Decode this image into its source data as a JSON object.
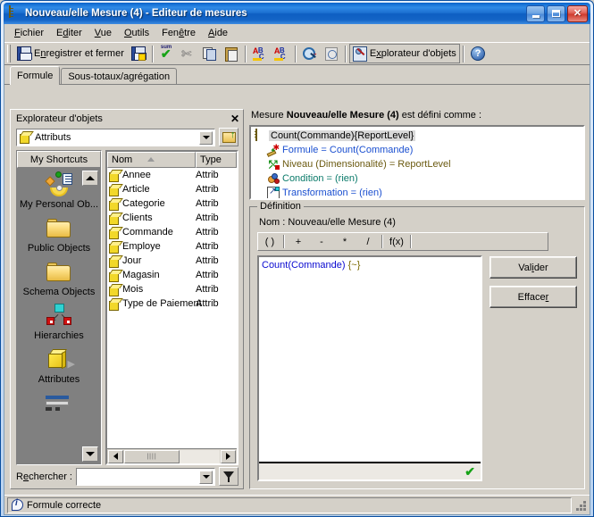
{
  "window": {
    "title": "Nouveau/elle Mesure (4) - Editeur de mesures",
    "icon": "ruler-icon",
    "buttons": {
      "minimize": "minimize-icon",
      "maximize": "maximize-icon",
      "close": "close-icon"
    }
  },
  "menubar": [
    {
      "label": "Fichier",
      "accel": "F"
    },
    {
      "label": "Editer",
      "accel": "d"
    },
    {
      "label": "Vue",
      "accel": "V"
    },
    {
      "label": "Outils",
      "accel": "O"
    },
    {
      "label": "Fenêtre",
      "accel": "ê"
    },
    {
      "label": "Aide",
      "accel": "A"
    }
  ],
  "toolbar": {
    "save_and_close": {
      "label": "Enregistrer et fermer",
      "icon": "save-icon"
    },
    "save_as": {
      "icon": "save-as-icon"
    },
    "validate": {
      "icon": "sum-check-icon"
    },
    "cut": {
      "icon": "scissors-icon"
    },
    "copy": {
      "icon": "copy-icon"
    },
    "paste": {
      "icon": "paste-icon"
    },
    "spell1": {
      "icon": "abc-sort-icon"
    },
    "spell2": {
      "icon": "abc-sort-desc-icon"
    },
    "find": {
      "icon": "find-icon"
    },
    "find_next": {
      "icon": "find-next-icon"
    },
    "object_explorer": {
      "label": "Explorateur d'objets",
      "icon": "object-explorer-icon"
    },
    "help": {
      "icon": "help-icon"
    }
  },
  "tabs": [
    {
      "label": "Formule",
      "active": true
    },
    {
      "label": "Sous-totaux/agrégation",
      "active": false
    }
  ],
  "object_explorer": {
    "title": "Explorateur d'objets",
    "close_label": "✕",
    "combo": {
      "value": "Attributs",
      "icon": "cube-icon"
    },
    "up_button_icon": "folder-up-icon",
    "shortcuts_title": "My Shortcuts",
    "shortcuts": [
      {
        "label": "My Personal Ob...",
        "icon": "personal-objects-icon"
      },
      {
        "label": "Public Objects",
        "icon": "folder-icon"
      },
      {
        "label": "Schema Objects",
        "icon": "folder-icon"
      },
      {
        "label": "Hierarchies",
        "icon": "hierarchies-icon"
      },
      {
        "label": "Attributes",
        "icon": "attributes-cube-icon"
      },
      {
        "label": "",
        "icon": "metrics-bar-icon"
      }
    ],
    "columns": [
      "Nom",
      "Type"
    ],
    "sort_column": "Nom",
    "sort_direction": "asc",
    "rows": [
      {
        "name": "Annee",
        "type": "Attrib"
      },
      {
        "name": "Article",
        "type": "Attrib"
      },
      {
        "name": "Categorie",
        "type": "Attrib"
      },
      {
        "name": "Clients",
        "type": "Attrib"
      },
      {
        "name": "Commande",
        "type": "Attrib"
      },
      {
        "name": "Employe",
        "type": "Attrib"
      },
      {
        "name": "Jour",
        "type": "Attrib"
      },
      {
        "name": "Magasin",
        "type": "Attrib"
      },
      {
        "name": "Mois",
        "type": "Attrib"
      },
      {
        "name": "Type de Paiement",
        "type": "Attrib"
      }
    ],
    "search": {
      "label": "Rechercher :",
      "value": "",
      "placeholder": "",
      "filter_icon": "funnel-icon"
    }
  },
  "measure": {
    "caption_prefix": "Mesure",
    "name": "Nouveau/elle Mesure (4)",
    "caption_suffix": "est défini comme :",
    "tree": [
      {
        "text": "Count(Commande){ReportLevel}",
        "icon": "ruler-icon",
        "selected": true,
        "color": "#000000"
      },
      {
        "text": "Formule = Count(Commande)",
        "icon": "formula-icon",
        "color": "#1a4fd0"
      },
      {
        "text": "Niveau (Dimensionalité) = ReportLevel",
        "icon": "level-icon",
        "color": "#6b5a10"
      },
      {
        "text": "Condition = (rien)",
        "icon": "condition-icon",
        "color": "#0a7a6a"
      },
      {
        "text": "Transformation = (rien)",
        "icon": "transformation-icon",
        "color": "#1a4fd0"
      }
    ]
  },
  "definition": {
    "legend": "Définition",
    "name_label": "Nom :",
    "name_value": "Nouveau/elle Mesure (4)",
    "operators": [
      "( )",
      "+",
      "-",
      "*",
      "/",
      "f(x)"
    ],
    "formula": "Count(Commande) ",
    "formula_braces": "{~}",
    "status_icon": "green-check-icon",
    "buttons": [
      {
        "label": "Valider",
        "accel": "i"
      },
      {
        "label": "Effacer",
        "accel": "r"
      }
    ]
  },
  "statusbar": {
    "icon": "info-icon",
    "text": "Formule correcte"
  }
}
